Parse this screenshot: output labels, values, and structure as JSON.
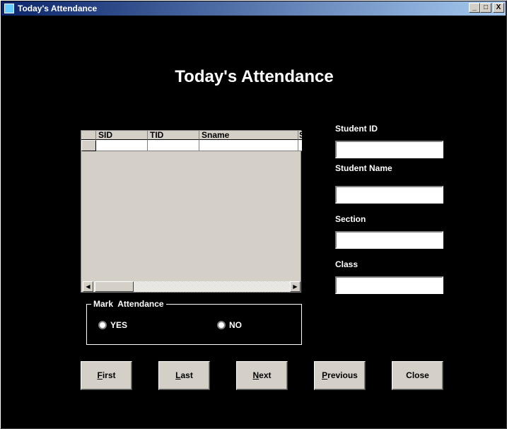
{
  "window": {
    "title": "Today's Attendance",
    "minimize": "_",
    "maximize": "□",
    "close": "X"
  },
  "heading": "Today's Attendance",
  "grid": {
    "columns": [
      "SID",
      "TID",
      "Sname",
      "S"
    ],
    "rows": [
      [
        "",
        "",
        ""
      ]
    ]
  },
  "fields": [
    {
      "label": "Student ID",
      "value": ""
    },
    {
      "label": "Student Name",
      "value": ""
    },
    {
      "label": "Section",
      "value": ""
    },
    {
      "label": "Class",
      "value": ""
    }
  ],
  "attendance": {
    "legend": "Mark  Attendance",
    "options": [
      {
        "label": "YES",
        "selected": false
      },
      {
        "label": "NO",
        "selected": false
      }
    ]
  },
  "buttons": [
    {
      "label": "First",
      "access_key": "F"
    },
    {
      "label": "Last",
      "access_key": "L"
    },
    {
      "label": "Next",
      "access_key": "N"
    },
    {
      "label": "Previous",
      "access_key": "P"
    },
    {
      "label": "Close",
      "access_key": ""
    }
  ]
}
